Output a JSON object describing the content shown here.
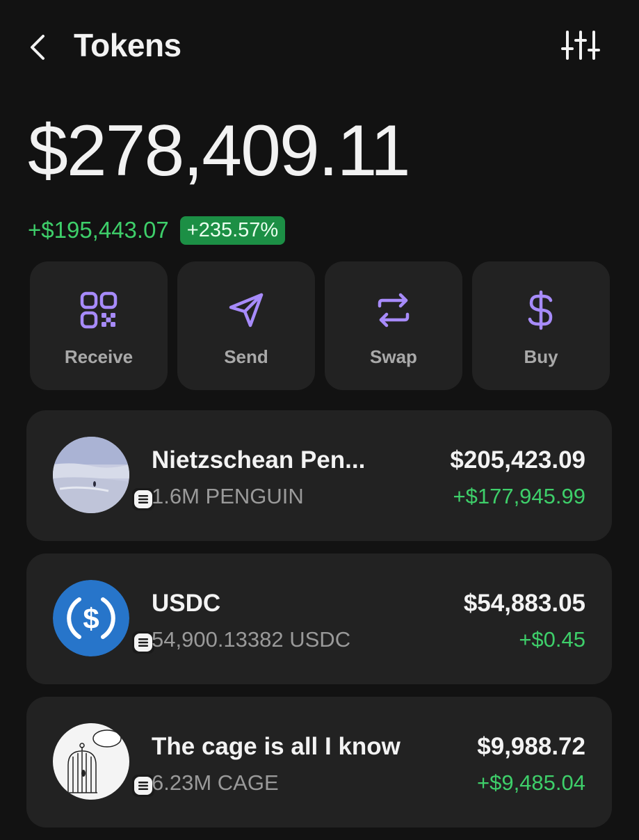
{
  "header": {
    "title": "Tokens",
    "back_icon": "chevron-left-icon",
    "filter_icon": "sliders-icon"
  },
  "portfolio": {
    "balance": "$278,409.11",
    "change_amount": "+$195,443.07",
    "change_percent": "+235.57%"
  },
  "actions": [
    {
      "label": "Receive",
      "icon": "qr-code-icon"
    },
    {
      "label": "Send",
      "icon": "send-icon"
    },
    {
      "label": "Swap",
      "icon": "swap-icon"
    },
    {
      "label": "Buy",
      "icon": "dollar-icon"
    }
  ],
  "tokens": [
    {
      "name": "Nietzschean Pen...",
      "amount": "1.6M PENGUIN",
      "value": "$205,423.09",
      "change": "+$177,945.99"
    },
    {
      "name": "USDC",
      "amount": "54,900.13382 USDC",
      "value": "$54,883.05",
      "change": "+$0.45"
    },
    {
      "name": "The cage is all I know",
      "amount": "6.23M CAGE",
      "value": "$9,988.72",
      "change": "+$9,485.04"
    }
  ],
  "colors": {
    "background": "#121212",
    "card": "#222222",
    "accent_purple": "#a78bfa",
    "positive_green": "#3ecf6a",
    "usdc_blue": "#2775ca"
  }
}
